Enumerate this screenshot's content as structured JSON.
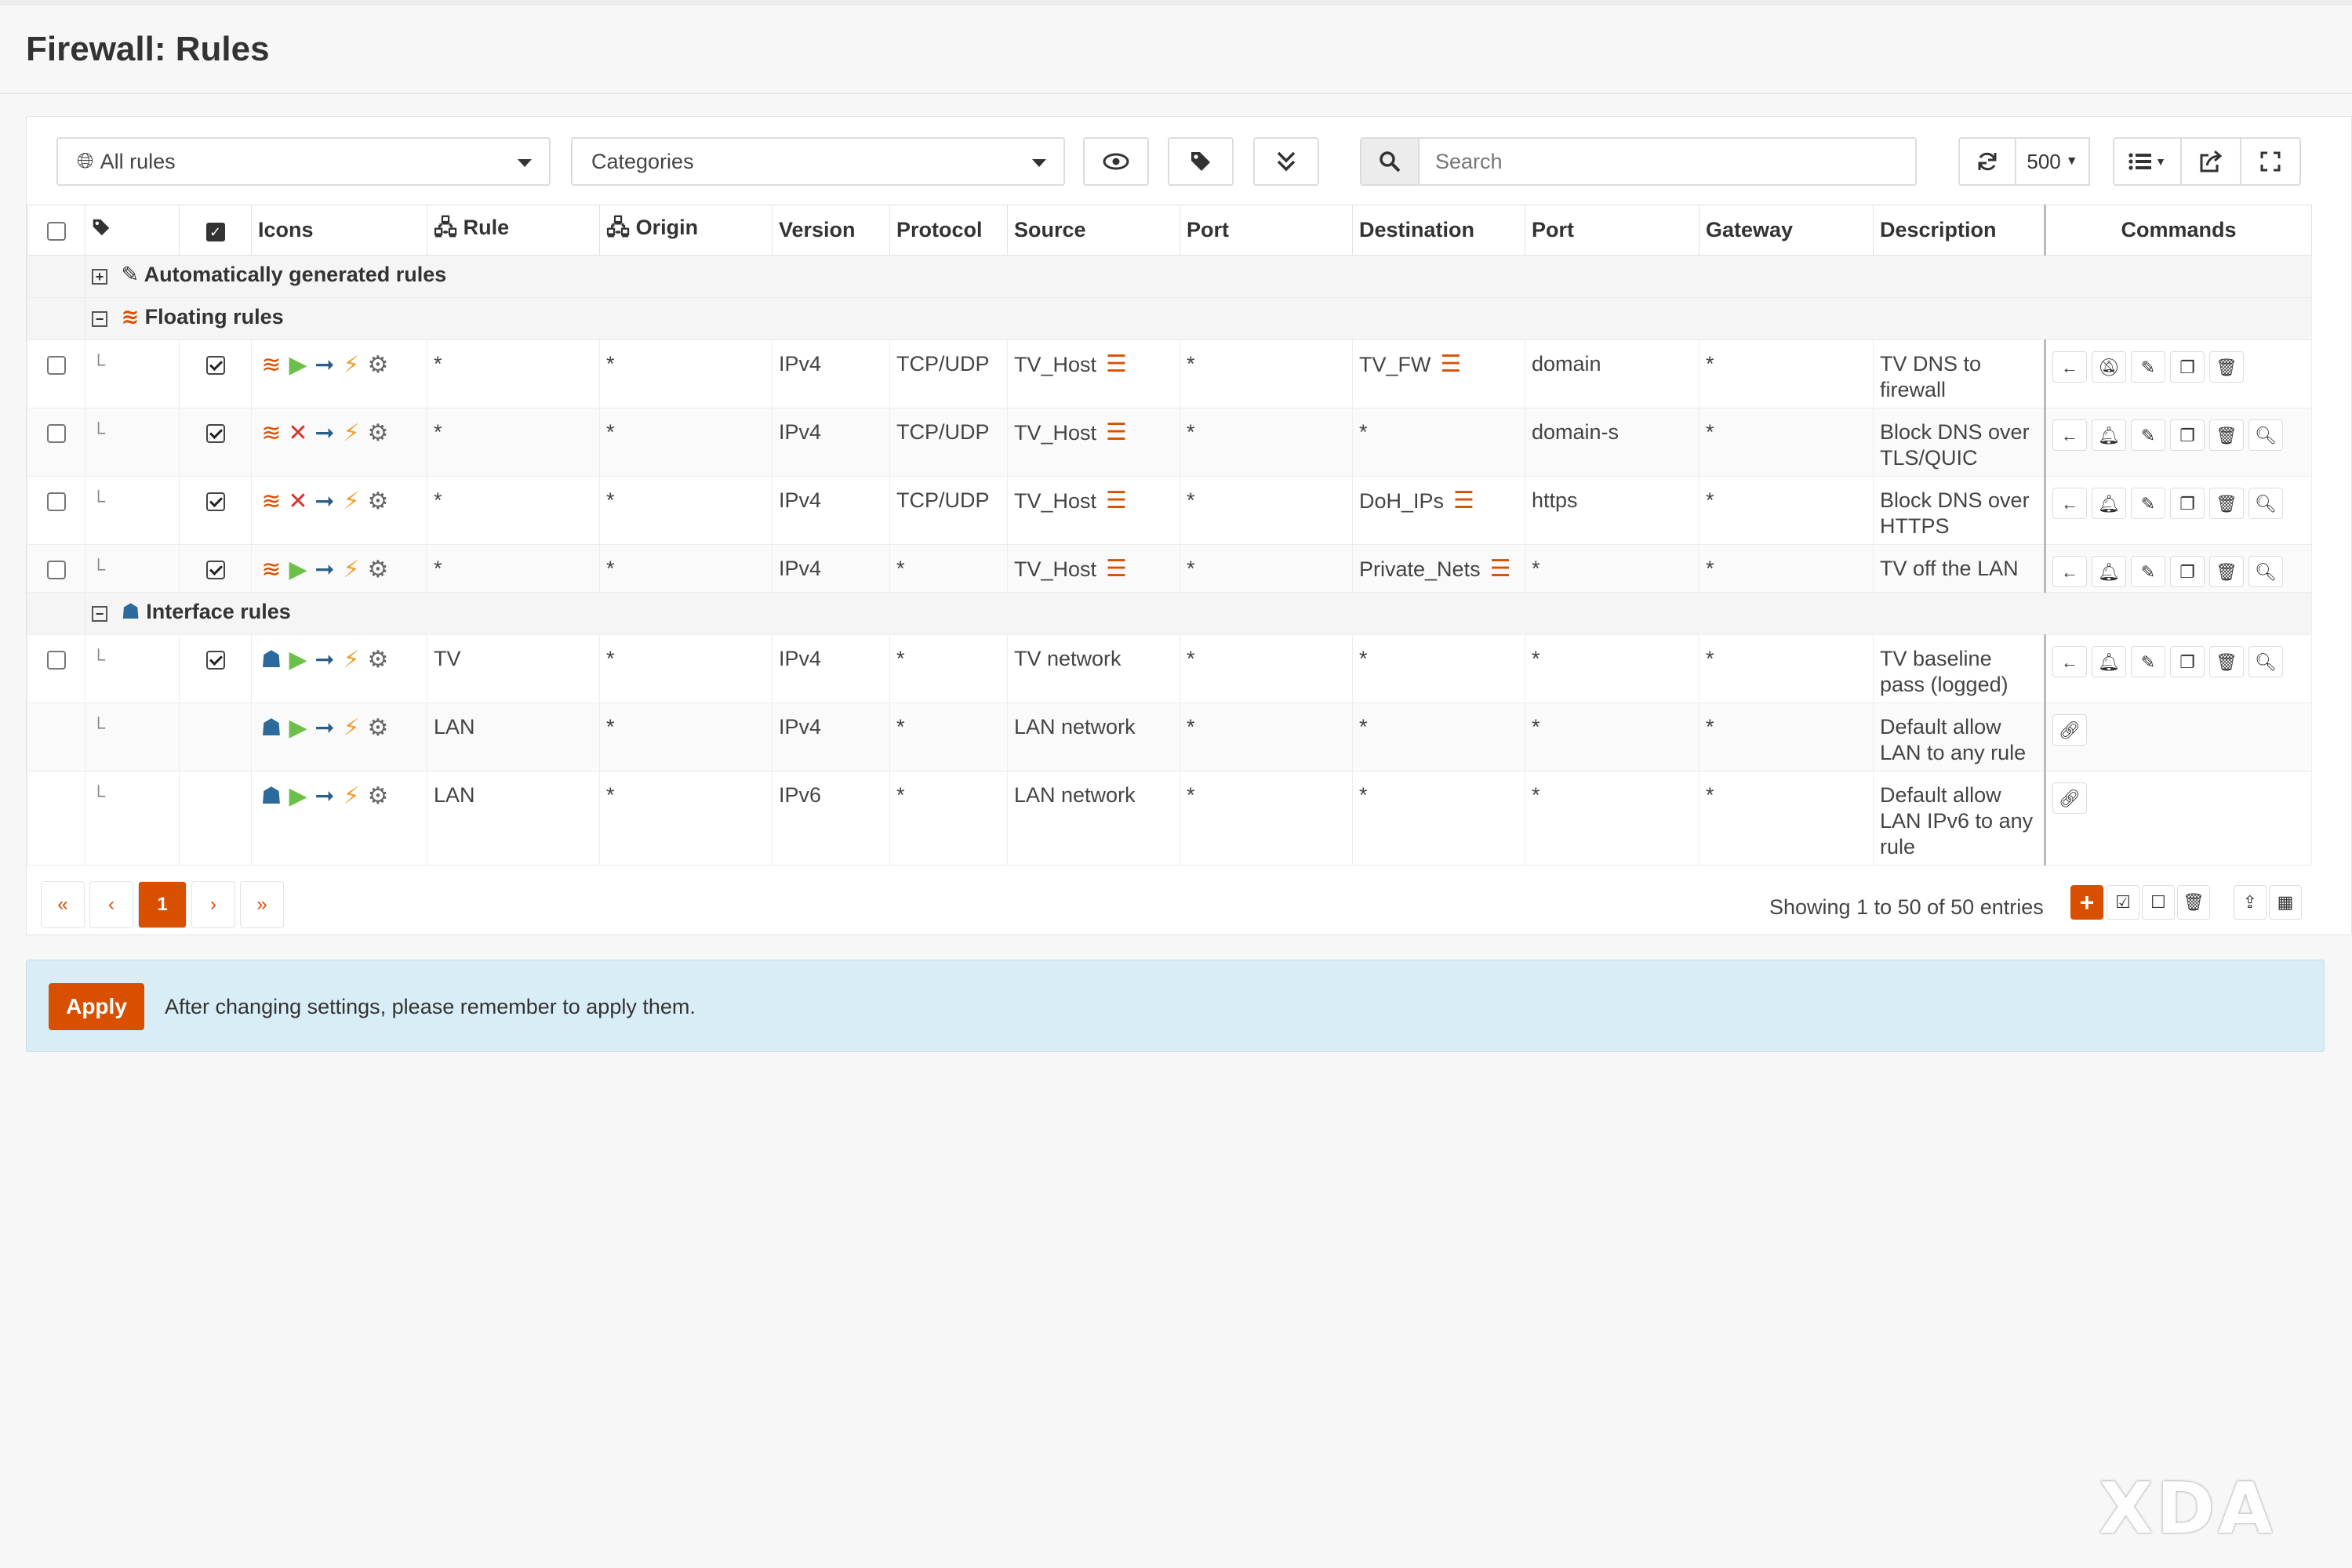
{
  "page_title": "Firewall: Rules",
  "toolbar": {
    "rules_select": "All rules",
    "categories_select": "Categories",
    "search_placeholder": "Search",
    "page_size": "500"
  },
  "columns": [
    "Icons",
    "Rule",
    "Origin",
    "Version",
    "Protocol",
    "Source",
    "Port",
    "Destination",
    "Port",
    "Gateway",
    "Description",
    "Commands"
  ],
  "groups": {
    "auto": "Automatically generated rules",
    "floating": "Floating rules",
    "interface": "Interface rules"
  },
  "floating_rules": [
    {
      "rule": "*",
      "origin": "*",
      "version": "IPv4",
      "protocol": "TCP/UDP",
      "source": "TV_Host",
      "sport": "*",
      "dest": "TV_FW",
      "dport": "domain",
      "gateway": "*",
      "desc": "TV DNS to firewall"
    },
    {
      "rule": "*",
      "origin": "*",
      "version": "IPv4",
      "protocol": "TCP/UDP",
      "source": "TV_Host",
      "sport": "*",
      "dest": "*",
      "dport": "domain-s",
      "gateway": "*",
      "desc": "Block DNS over TLS/QUIC"
    },
    {
      "rule": "*",
      "origin": "*",
      "version": "IPv4",
      "protocol": "TCP/UDP",
      "source": "TV_Host",
      "sport": "*",
      "dest": "DoH_IPs",
      "dport": "https",
      "gateway": "*",
      "desc": "Block DNS over HTTPS"
    },
    {
      "rule": "*",
      "origin": "*",
      "version": "IPv4",
      "protocol": "*",
      "source": "TV_Host",
      "sport": "*",
      "dest": "Private_Nets",
      "dport": "*",
      "gateway": "*",
      "desc": "TV off the LAN"
    }
  ],
  "interface_rules": [
    {
      "rule": "TV",
      "origin": "*",
      "version": "IPv4",
      "protocol": "*",
      "source": "TV network",
      "sport": "*",
      "dest": "*",
      "dport": "*",
      "gateway": "*",
      "desc": "TV baseline pass (logged)"
    },
    {
      "rule": "LAN",
      "origin": "*",
      "version": "IPv4",
      "protocol": "*",
      "source": "LAN network",
      "sport": "*",
      "dest": "*",
      "dport": "*",
      "gateway": "*",
      "desc": "Default allow LAN to any rule"
    },
    {
      "rule": "LAN",
      "origin": "*",
      "version": "IPv6",
      "protocol": "*",
      "source": "LAN network",
      "sport": "*",
      "dest": "*",
      "dport": "*",
      "gateway": "*",
      "desc": "Default allow LAN IPv6 to any rule"
    }
  ],
  "pagination": {
    "first": "«",
    "prev": "‹",
    "current": "1",
    "next": "›",
    "last": "»"
  },
  "showing": "Showing 1 to 50 of 50 entries",
  "notice": {
    "apply": "Apply",
    "text": "After changing settings, please remember to apply them."
  },
  "watermark": "XDA",
  "colors": {
    "accent": "#d94f00",
    "pass": "#6cc04a",
    "block": "#d9342b",
    "notice_bg": "#d9edf7"
  }
}
